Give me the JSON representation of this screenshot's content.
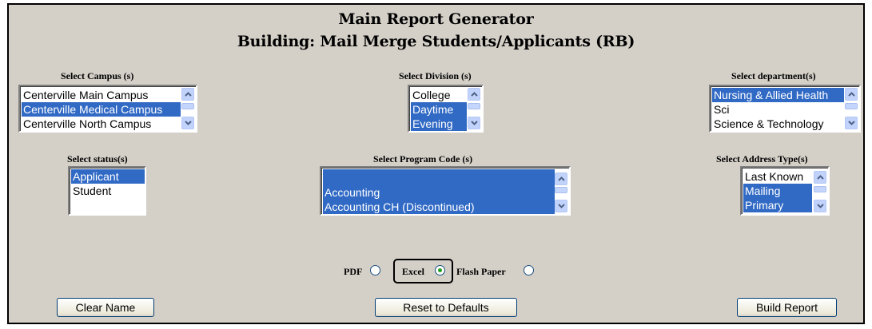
{
  "header": {
    "title": "Main Report Generator",
    "subtitle": "Building: Mail Merge Students/Applicants (RB)"
  },
  "campus": {
    "label": "Select Campus (s)",
    "options": [
      {
        "text": "Centerville Main Campus",
        "selected": false
      },
      {
        "text": "Centerville Medical Campus",
        "selected": true
      },
      {
        "text": "Centerville North Campus",
        "selected": false
      }
    ]
  },
  "division": {
    "label": "Select Division (s)",
    "options": [
      {
        "text": "College",
        "selected": false
      },
      {
        "text": "Daytime",
        "selected": true
      },
      {
        "text": "Evening",
        "selected": true
      }
    ]
  },
  "department": {
    "label": "Select department(s)",
    "options": [
      {
        "text": "Nursing & Allied Health",
        "selected": true
      },
      {
        "text": "Sci",
        "selected": false
      },
      {
        "text": "Science & Technology",
        "selected": false
      }
    ]
  },
  "status": {
    "label": "Select status(s)",
    "options": [
      {
        "text": "Applicant",
        "selected": true
      },
      {
        "text": "Student",
        "selected": false
      }
    ]
  },
  "program": {
    "label": "Select Program Code (s)",
    "options": [
      {
        "text": "",
        "selected": true
      },
      {
        "text": "",
        "selected": true
      },
      {
        "text": "Accounting",
        "selected": true
      },
      {
        "text": "Accounting CH (Discontinued)",
        "selected": true
      }
    ]
  },
  "address": {
    "label": "Select Address Type(s)",
    "options": [
      {
        "text": "Last Known",
        "selected": false
      },
      {
        "text": "Mailing",
        "selected": true
      },
      {
        "text": "Primary",
        "selected": true
      }
    ]
  },
  "format": {
    "pdf_label": "PDF",
    "excel_label": "Excel",
    "flash_label": "Flash Paper",
    "selected": "Excel"
  },
  "buttons": {
    "clear": "Clear Name",
    "reset": "Reset to Defaults",
    "build": "Build Report"
  },
  "colors": {
    "selection": "#316ac5",
    "panel": "#d4d0c8",
    "scrollbar": "#c1d3fb"
  }
}
